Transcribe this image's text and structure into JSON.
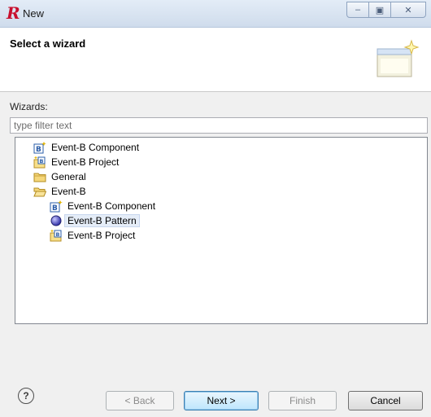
{
  "window": {
    "title": "New"
  },
  "header": {
    "title": "Select a wizard"
  },
  "wizards": {
    "label": "Wizards:",
    "filter_placeholder": "type filter text",
    "tree": [
      {
        "label": "Event-B Component",
        "icon": "event-b-component-icon",
        "depth": 0
      },
      {
        "label": "Event-B Project",
        "icon": "event-b-project-icon",
        "depth": 0
      },
      {
        "label": "General",
        "icon": "folder-icon",
        "depth": 0
      },
      {
        "label": "Event-B",
        "icon": "folder-open-icon",
        "depth": 0
      },
      {
        "label": "Event-B Component",
        "icon": "event-b-component-icon",
        "depth": 1
      },
      {
        "label": "Event-B Pattern",
        "icon": "pattern-icon",
        "depth": 1,
        "selected": true
      },
      {
        "label": "Event-B Project",
        "icon": "event-b-project-icon",
        "depth": 1
      }
    ]
  },
  "buttons": {
    "help": "?",
    "back": "< Back",
    "next": "Next >",
    "finish": "Finish",
    "cancel": "Cancel"
  }
}
